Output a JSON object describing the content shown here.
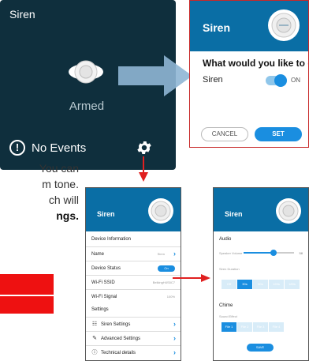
{
  "tile": {
    "title": "Siren",
    "status": "Armed",
    "events_icon_glyph": "!",
    "events": "No Events"
  },
  "dialog": {
    "title": "Siren",
    "question": "What would you like to do?",
    "row_label": "Siren",
    "toggle_label": "ON",
    "cancel": "CANCEL",
    "set": "SET"
  },
  "fragment": {
    "line1": "You can",
    "line2": "m tone.",
    "line3": "ch will",
    "line4": "ngs."
  },
  "device_screen": {
    "title": "Siren",
    "section_info": "Device Information",
    "name_label": "Name",
    "name_value": "Siren",
    "status_label": "Device Status",
    "status_value": "On",
    "ssid_label": "Wi-Fi SSID",
    "ssid_value": "BelkingH4S5C7",
    "signal_label": "Wi-Fi Signal",
    "signal_value": "100%",
    "section_settings": "Settings",
    "siren_settings": "Siren Settings",
    "advanced_settings": "Advanced Settings",
    "technical_details": "Technical details",
    "chevron": "›"
  },
  "siren_screen": {
    "title": "Siren",
    "section_audio": "Audio",
    "volume_label": "Speaker Volume",
    "volume_value": "58",
    "volume_fraction": 0.6,
    "duration_label": "Siren Duration",
    "durations": [
      "Off",
      "30s",
      "60s",
      "120s",
      "180s"
    ],
    "duration_active": 1,
    "section_chime": "Chime",
    "effect_label": "Sound Effect",
    "effects": [
      "File 1",
      "File 2",
      "File 3",
      "File 4"
    ],
    "effect_active": 0,
    "save": "SAVE"
  },
  "colors": {
    "tile_bg": "#0f2f3d",
    "header_blue": "#0a6ea5",
    "accent": "#1a8ee0",
    "arrow_red": "#e02020",
    "arrow_light_blue": "#8fb6d4"
  }
}
